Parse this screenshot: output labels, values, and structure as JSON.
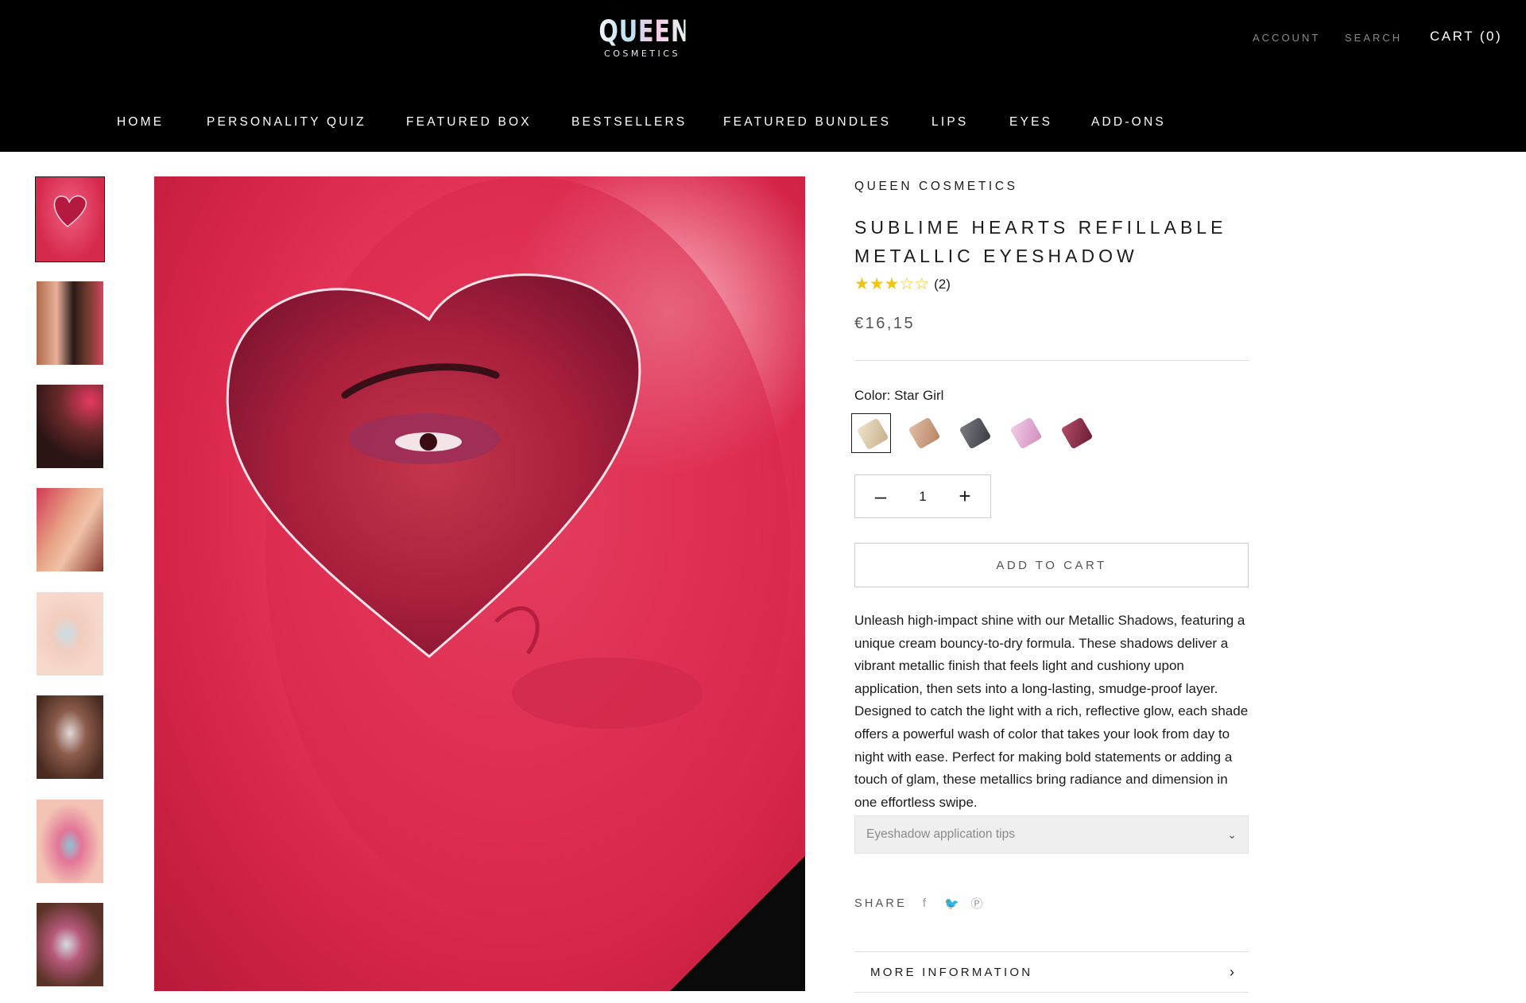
{
  "header": {
    "logo_main": "QUEEN",
    "logo_sub": "COSMETICS",
    "account_label": "ACCOUNT",
    "search_label": "SEARCH",
    "cart_label": "CART (0)",
    "nav": [
      {
        "label": "HOME"
      },
      {
        "label": "PERSONALITY QUIZ"
      },
      {
        "label": "FEATURED BOX"
      },
      {
        "label": "BESTSELLERS"
      },
      {
        "label": "FEATURED BUNDLES"
      },
      {
        "label": "LIPS"
      },
      {
        "label": "EYES"
      },
      {
        "label": "ADD-ONS"
      }
    ]
  },
  "gallery": {
    "thumbnail_count": 8,
    "selected_index": 0
  },
  "product": {
    "vendor": "QUEEN COSMETICS",
    "title": "SUBLIME HEARTS REFILLABLE METALLIC EYESHADOW",
    "rating": 3,
    "rating_max": 5,
    "rating_count": "(2)",
    "price": "€16,15",
    "color_label": "Color: Star Girl",
    "swatches": [
      {
        "color": "#d8c7a8",
        "selected": true
      },
      {
        "color": "#c79b7f",
        "selected": false
      },
      {
        "color": "#55565c",
        "selected": false
      },
      {
        "color": "#e3a8d2",
        "selected": false
      },
      {
        "color": "#8c2f4a",
        "selected": false
      }
    ],
    "quantity": "1",
    "add_to_cart_label": "ADD TO CART",
    "description": "Unleash high-impact shine with our Metallic Shadows, featuring a unique cream bouncy-to-dry formula. These shadows deliver a vibrant metallic finish that feels light and cushiony upon application, then sets into a long-lasting, smudge-proof layer. Designed to catch the light with a rich, reflective glow, each shade offers a powerful wash of color that takes your look from day to night with ease. Perfect for making bold statements or adding a touch of glam, these metallics bring radiance and dimension in one effortless swipe.",
    "tips_label": "Eyeshadow application tips",
    "share_label": "SHARE",
    "more_info_label": "MORE INFORMATION"
  },
  "colors": {
    "header_bg": "#000000",
    "accent_star": "#f1c40f",
    "main_image_pink": "#e83a5c"
  }
}
